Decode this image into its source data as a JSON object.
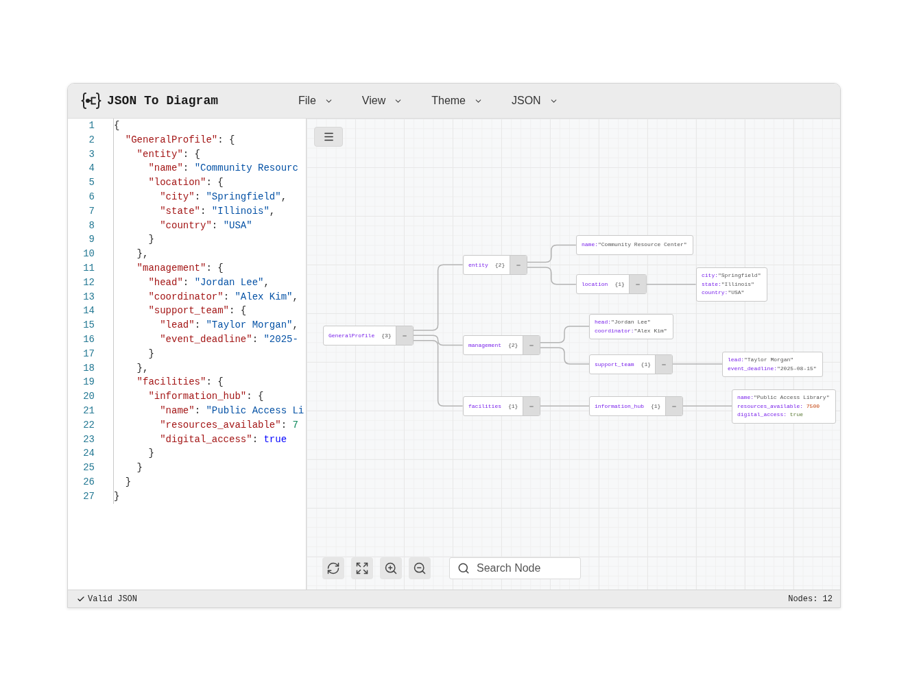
{
  "app": {
    "title": "JSON To Diagram"
  },
  "menus": [
    {
      "label": "File"
    },
    {
      "label": "View"
    },
    {
      "label": "Theme"
    },
    {
      "label": "JSON"
    }
  ],
  "editor": {
    "lines": [
      {
        "number": "1",
        "tokens": [
          {
            "kind": "punct",
            "text": "{"
          }
        ]
      },
      {
        "number": "2",
        "tokens": [
          {
            "kind": "key",
            "text": "  \"GeneralProfile\""
          },
          {
            "kind": "punct",
            "text": ": {"
          }
        ]
      },
      {
        "number": "3",
        "tokens": [
          {
            "kind": "key",
            "text": "    \"entity\""
          },
          {
            "kind": "punct",
            "text": ": {"
          }
        ]
      },
      {
        "number": "4",
        "tokens": [
          {
            "kind": "key",
            "text": "      \"name\""
          },
          {
            "kind": "punct",
            "text": ": "
          },
          {
            "kind": "string",
            "text": "\"Community Resourc"
          }
        ]
      },
      {
        "number": "5",
        "tokens": [
          {
            "kind": "key",
            "text": "      \"location\""
          },
          {
            "kind": "punct",
            "text": ": {"
          }
        ]
      },
      {
        "number": "6",
        "tokens": [
          {
            "kind": "key",
            "text": "        \"city\""
          },
          {
            "kind": "punct",
            "text": ": "
          },
          {
            "kind": "string",
            "text": "\"Springfield\""
          },
          {
            "kind": "punct",
            "text": ","
          }
        ]
      },
      {
        "number": "7",
        "tokens": [
          {
            "kind": "key",
            "text": "        \"state\""
          },
          {
            "kind": "punct",
            "text": ": "
          },
          {
            "kind": "string",
            "text": "\"Illinois\""
          },
          {
            "kind": "punct",
            "text": ","
          }
        ]
      },
      {
        "number": "8",
        "tokens": [
          {
            "kind": "key",
            "text": "        \"country\""
          },
          {
            "kind": "punct",
            "text": ": "
          },
          {
            "kind": "string",
            "text": "\"USA\""
          }
        ]
      },
      {
        "number": "9",
        "tokens": [
          {
            "kind": "punct",
            "text": "      }"
          }
        ]
      },
      {
        "number": "10",
        "tokens": [
          {
            "kind": "punct",
            "text": "    },"
          }
        ]
      },
      {
        "number": "11",
        "tokens": [
          {
            "kind": "key",
            "text": "    \"management\""
          },
          {
            "kind": "punct",
            "text": ": {"
          }
        ]
      },
      {
        "number": "12",
        "tokens": [
          {
            "kind": "key",
            "text": "      \"head\""
          },
          {
            "kind": "punct",
            "text": ": "
          },
          {
            "kind": "string",
            "text": "\"Jordan Lee\""
          },
          {
            "kind": "punct",
            "text": ","
          }
        ]
      },
      {
        "number": "13",
        "tokens": [
          {
            "kind": "key",
            "text": "      \"coordinator\""
          },
          {
            "kind": "punct",
            "text": ": "
          },
          {
            "kind": "string",
            "text": "\"Alex Kim\""
          },
          {
            "kind": "punct",
            "text": ","
          }
        ]
      },
      {
        "number": "14",
        "tokens": [
          {
            "kind": "key",
            "text": "      \"support_team\""
          },
          {
            "kind": "punct",
            "text": ": {"
          }
        ]
      },
      {
        "number": "15",
        "tokens": [
          {
            "kind": "key",
            "text": "        \"lead\""
          },
          {
            "kind": "punct",
            "text": ": "
          },
          {
            "kind": "string",
            "text": "\"Taylor Morgan\""
          },
          {
            "kind": "punct",
            "text": ","
          }
        ]
      },
      {
        "number": "16",
        "tokens": [
          {
            "kind": "key",
            "text": "        \"event_deadline\""
          },
          {
            "kind": "punct",
            "text": ": "
          },
          {
            "kind": "string",
            "text": "\"2025-"
          }
        ]
      },
      {
        "number": "17",
        "tokens": [
          {
            "kind": "punct",
            "text": "      }"
          }
        ]
      },
      {
        "number": "18",
        "tokens": [
          {
            "kind": "punct",
            "text": "    },"
          }
        ]
      },
      {
        "number": "19",
        "tokens": [
          {
            "kind": "key",
            "text": "    \"facilities\""
          },
          {
            "kind": "punct",
            "text": ": {"
          }
        ]
      },
      {
        "number": "20",
        "tokens": [
          {
            "kind": "key",
            "text": "      \"information_hub\""
          },
          {
            "kind": "punct",
            "text": ": {"
          }
        ]
      },
      {
        "number": "21",
        "tokens": [
          {
            "kind": "key",
            "text": "        \"name\""
          },
          {
            "kind": "punct",
            "text": ": "
          },
          {
            "kind": "string",
            "text": "\"Public Access Li"
          }
        ]
      },
      {
        "number": "22",
        "tokens": [
          {
            "kind": "key",
            "text": "        \"resources_available\""
          },
          {
            "kind": "punct",
            "text": ": "
          },
          {
            "kind": "number",
            "text": "7"
          }
        ]
      },
      {
        "number": "23",
        "tokens": [
          {
            "kind": "key",
            "text": "        \"digital_access\""
          },
          {
            "kind": "punct",
            "text": ": "
          },
          {
            "kind": "boolean",
            "text": "true"
          }
        ]
      },
      {
        "number": "24",
        "tokens": [
          {
            "kind": "punct",
            "text": "      }"
          }
        ]
      },
      {
        "number": "25",
        "tokens": [
          {
            "kind": "punct",
            "text": "    }"
          }
        ]
      },
      {
        "number": "26",
        "tokens": [
          {
            "kind": "punct",
            "text": "  }"
          }
        ]
      },
      {
        "number": "27",
        "tokens": [
          {
            "kind": "punct",
            "text": "}"
          }
        ]
      }
    ]
  },
  "diagram": {
    "root": {
      "kind": "object",
      "key": "GeneralProfile",
      "count": "{3}",
      "expanded": true,
      "children": [
        {
          "kind": "object",
          "key": "entity",
          "count": "{2}",
          "expanded": true,
          "children": [
            {
              "kind": "values",
              "fields": [
                {
                  "key": "name:",
                  "value": "\"Community Resource Center\"",
                  "kind": "string"
                }
              ]
            },
            {
              "kind": "object",
              "key": "location",
              "count": "{1}",
              "expanded": true,
              "children": [
                {
                  "kind": "values",
                  "fields": [
                    {
                      "key": "city:",
                      "value": "\"Springfield\"",
                      "kind": "string"
                    },
                    {
                      "key": "state:",
                      "value": "\"Illinois\"",
                      "kind": "string"
                    },
                    {
                      "key": "country:",
                      "value": "\"USA\"",
                      "kind": "string"
                    }
                  ]
                }
              ]
            }
          ]
        },
        {
          "kind": "object",
          "key": "management",
          "count": "{2}",
          "expanded": true,
          "children": [
            {
              "kind": "values",
              "fields": [
                {
                  "key": "head:",
                  "value": "\"Jordan Lee\"",
                  "kind": "string"
                },
                {
                  "key": "coordinator:",
                  "value": "\"Alex Kim\"",
                  "kind": "string"
                }
              ]
            },
            {
              "kind": "object",
              "key": "support_team",
              "count": "{1}",
              "expanded": true,
              "children": [
                {
                  "kind": "values",
                  "fields": [
                    {
                      "key": "lead:",
                      "value": "\"Taylor Morgan\"",
                      "kind": "string"
                    },
                    {
                      "key": "event_deadline:",
                      "value": "\"2025-08-15\"",
                      "kind": "string"
                    }
                  ]
                }
              ]
            }
          ]
        },
        {
          "kind": "object",
          "key": "facilities",
          "count": "{1}",
          "expanded": true,
          "children": [
            {
              "kind": "object",
              "key": "information_hub",
              "count": "{1}",
              "expanded": true,
              "children": [
                {
                  "kind": "values",
                  "fields": [
                    {
                      "key": "name:",
                      "value": "\"Public Access Library\"",
                      "kind": "string"
                    },
                    {
                      "key": "resources_available:",
                      "value": "7500",
                      "kind": "number"
                    },
                    {
                      "key": "digital_access:",
                      "value": "true",
                      "kind": "boolean"
                    }
                  ]
                }
              ]
            }
          ]
        }
      ]
    }
  },
  "toolbar": {
    "search": {
      "placeholder": "Search Node"
    }
  },
  "status_bar": {
    "valid": true,
    "message": "Valid JSON",
    "node_count": "Nodes: 12"
  }
}
